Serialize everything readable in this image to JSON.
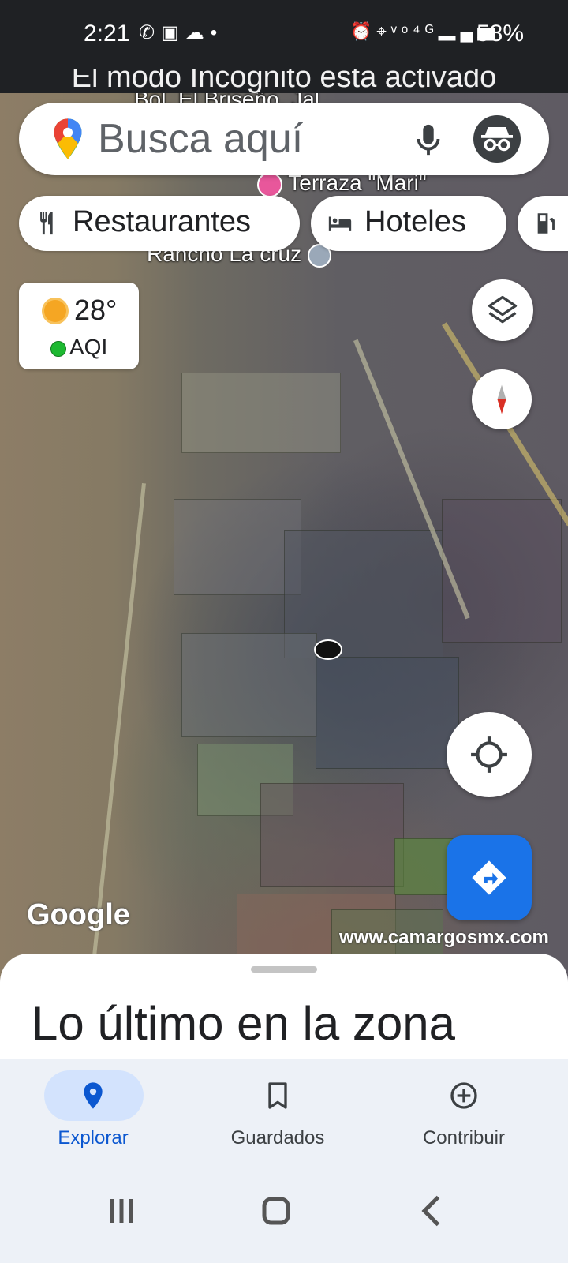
{
  "status_bar": {
    "time": "2:21",
    "battery": "58%",
    "left_icons": [
      "whatsapp-icon",
      "gallery-icon",
      "weather-icon",
      "dot-icon"
    ],
    "right_icons": [
      "alarm-icon",
      "location-icon",
      "volte-icon",
      "4g-icon",
      "signal-icon"
    ]
  },
  "incognito_banner": "El modo Incógnito está activado",
  "search": {
    "placeholder": "Busca aquí"
  },
  "chips": [
    {
      "label": "Restaurantes",
      "icon": "restaurant-icon"
    },
    {
      "label": "Hoteles",
      "icon": "hotel-icon"
    },
    {
      "label": "",
      "icon": "gas-station-icon"
    }
  ],
  "weather": {
    "temperature": "28°",
    "aqi_label": "AQI"
  },
  "map": {
    "labels": {
      "top": "Bol. El Briseño, Jal",
      "terraza": "Terraza \"Mari\"",
      "rancho": "Rancho La cruz"
    },
    "google_logo": "Google",
    "watermark": "www.camargosmx.com"
  },
  "sheet": {
    "title": "Lo último en la zona"
  },
  "bottom_nav": {
    "items": [
      {
        "label": "Explorar",
        "icon": "location-pin-icon",
        "active": true
      },
      {
        "label": "Guardados",
        "icon": "bookmark-icon",
        "active": false
      },
      {
        "label": "Contribuir",
        "icon": "add-circle-icon",
        "active": false
      }
    ]
  },
  "colors": {
    "accent_blue": "#1a73e8",
    "active_pill": "#d3e3fd",
    "nav_bg": "#edf1f7",
    "status_bg": "#1f2124"
  }
}
